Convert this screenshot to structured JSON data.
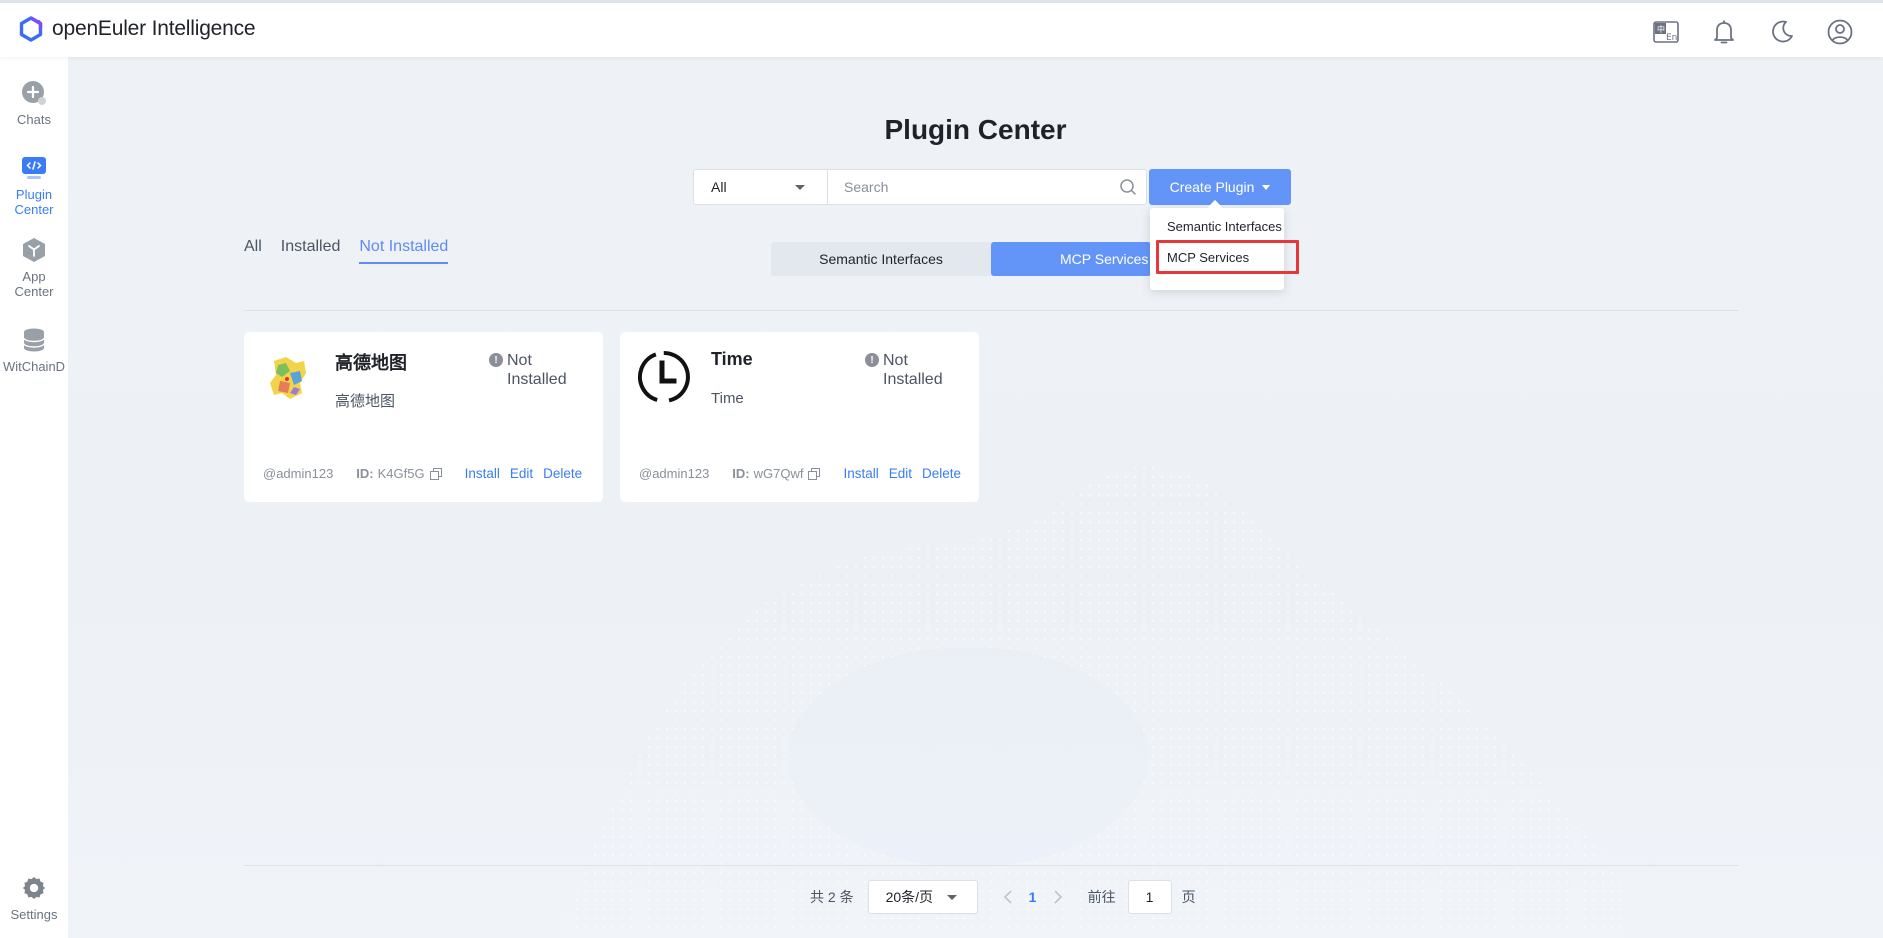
{
  "header": {
    "app_title": "openEuler Intelligence",
    "icons": [
      "language-switch-icon",
      "bell-icon",
      "moon-icon",
      "user-icon"
    ]
  },
  "sidebar": {
    "items": [
      {
        "label": "Chats",
        "icon": "new-chat-icon",
        "active": false
      },
      {
        "label": "Plugin Center",
        "icon": "plugin-icon",
        "active": true
      },
      {
        "label": "App Center",
        "icon": "cube-icon",
        "active": false
      },
      {
        "label": "WitChainD",
        "icon": "database-icon",
        "active": false
      }
    ],
    "settings_label": "Settings"
  },
  "page": {
    "title": "Plugin Center",
    "filter_select": "All",
    "search_placeholder": "Search",
    "create_button": "Create Plugin",
    "create_menu": [
      "Semantic Interfaces",
      "MCP Services"
    ],
    "type_tabs": [
      "Semantic Interfaces",
      "MCP Services"
    ],
    "status_tabs": [
      "All",
      "Installed",
      "Not Installed"
    ]
  },
  "cards": [
    {
      "name": "高德地图",
      "description": "高德地图",
      "status": "Not Installed",
      "owner": "@admin123",
      "id_label": "ID:",
      "id": "K4Gf5G",
      "actions": [
        "Install",
        "Edit",
        "Delete"
      ]
    },
    {
      "name": "Time",
      "description": "Time",
      "status": "Not Installed",
      "owner": "@admin123",
      "id_label": "ID:",
      "id": "wG7Qwf",
      "actions": [
        "Install",
        "Edit",
        "Delete"
      ]
    }
  ],
  "pagination": {
    "total_text": "共 2 条",
    "page_size": "20条/页",
    "current_page": "1",
    "goto_label": "前往",
    "goto_value": "1",
    "page_suffix": "页"
  },
  "colors": {
    "accent": "#6395f9",
    "link": "#3b7cf6",
    "highlight_box": "#e5383b"
  }
}
